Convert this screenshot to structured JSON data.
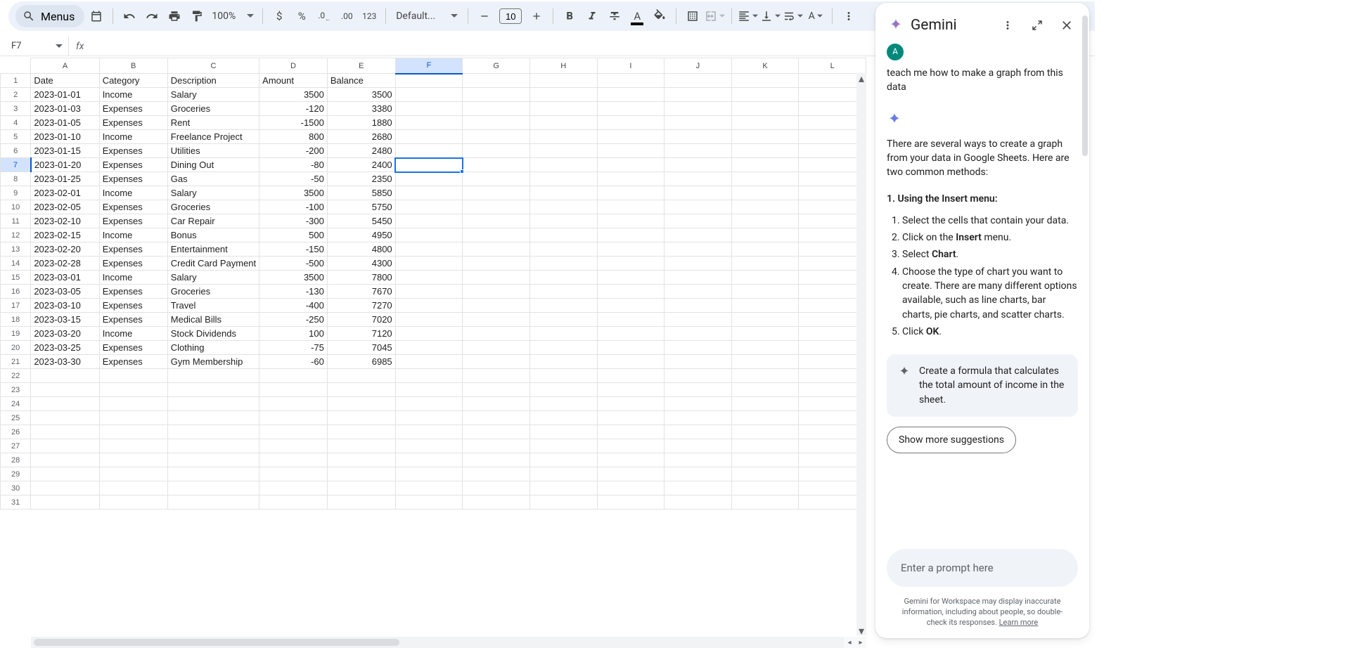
{
  "toolbar": {
    "menus_label": "Menus",
    "zoom": "100%",
    "font_name": "Default...",
    "font_size": "10"
  },
  "namebox": {
    "value": "F7"
  },
  "formula": {
    "value": ""
  },
  "columns": [
    "A",
    "B",
    "C",
    "D",
    "E",
    "F",
    "G",
    "H",
    "I",
    "J",
    "K",
    "L"
  ],
  "headers": [
    "Date",
    "Category",
    "Description",
    "Amount",
    "Balance"
  ],
  "rows": [
    [
      "2023-01-01",
      "Income",
      "Salary",
      "3500",
      "3500"
    ],
    [
      "2023-01-03",
      "Expenses",
      "Groceries",
      "-120",
      "3380"
    ],
    [
      "2023-01-05",
      "Expenses",
      "Rent",
      "-1500",
      "1880"
    ],
    [
      "2023-01-10",
      "Income",
      "Freelance Project",
      "800",
      "2680"
    ],
    [
      "2023-01-15",
      "Expenses",
      "Utilities",
      "-200",
      "2480"
    ],
    [
      "2023-01-20",
      "Expenses",
      "Dining Out",
      "-80",
      "2400"
    ],
    [
      "2023-01-25",
      "Expenses",
      "Gas",
      "-50",
      "2350"
    ],
    [
      "2023-02-01",
      "Income",
      "Salary",
      "3500",
      "5850"
    ],
    [
      "2023-02-05",
      "Expenses",
      "Groceries",
      "-100",
      "5750"
    ],
    [
      "2023-02-10",
      "Expenses",
      "Car Repair",
      "-300",
      "5450"
    ],
    [
      "2023-02-15",
      "Income",
      "Bonus",
      "500",
      "4950"
    ],
    [
      "2023-02-20",
      "Expenses",
      "Entertainment",
      "-150",
      "4800"
    ],
    [
      "2023-02-28",
      "Expenses",
      "Credit Card Payment",
      "-500",
      "4300"
    ],
    [
      "2023-03-01",
      "Income",
      "Salary",
      "3500",
      "7800"
    ],
    [
      "2023-03-05",
      "Expenses",
      "Groceries",
      "-130",
      "7670"
    ],
    [
      "2023-03-10",
      "Expenses",
      "Travel",
      "-400",
      "7270"
    ],
    [
      "2023-03-15",
      "Expenses",
      "Medical Bills",
      "-250",
      "7020"
    ],
    [
      "2023-03-20",
      "Income",
      "Stock Dividends",
      "100",
      "7120"
    ],
    [
      "2023-03-25",
      "Expenses",
      "Clothing",
      "-75",
      "7045"
    ],
    [
      "2023-03-30",
      "Expenses",
      "Gym Membership",
      "-60",
      "6985"
    ]
  ],
  "selected_cell": {
    "row": 7,
    "col": "F"
  },
  "gemini": {
    "title": "Gemini",
    "user_initial": "A",
    "user_msg": "teach me how to make a graph from this data",
    "intro": "There are several ways to create a graph from your data in Google Sheets. Here are two common methods:",
    "section1_title": "1. Using the Insert menu:",
    "steps": [
      {
        "pre": "Select the cells that contain your data.",
        "b": "",
        "post": ""
      },
      {
        "pre": "Click on the ",
        "b": "Insert",
        "post": " menu."
      },
      {
        "pre": "Select ",
        "b": "Chart",
        "post": "."
      },
      {
        "pre": "Choose the type of chart you want to create. There are many different options available, such as line charts, bar charts, pie charts, and scatter charts.",
        "b": "",
        "post": ""
      },
      {
        "pre": "Click ",
        "b": "OK",
        "post": "."
      }
    ],
    "suggestion": "Create a formula that calculates the total amount of income in the sheet.",
    "show_more": "Show more suggestions",
    "prompt_placeholder": "Enter a prompt here",
    "disclaimer_a": "Gemini for Workspace may display inaccurate information, including about people, so double-check its responses. ",
    "disclaimer_link": "Learn more"
  }
}
